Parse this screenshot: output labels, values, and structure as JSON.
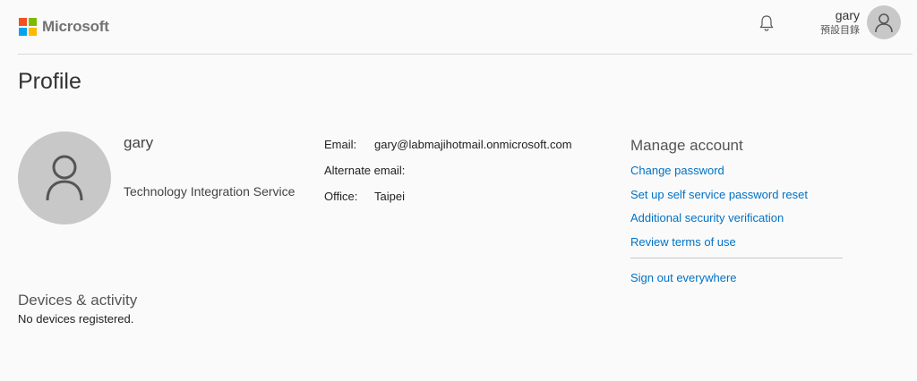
{
  "header": {
    "brand": "Microsoft",
    "user_name": "gary",
    "directory": "預設目錄"
  },
  "profile": {
    "page_title": "Profile",
    "name": "gary",
    "department": "Technology Integration Service",
    "email_label": "Email:",
    "email_value": "gary@labmajihotmail.onmicrosoft.com",
    "alternate_email_label": "Alternate email:",
    "alternate_email_value": "",
    "office_label": "Office:",
    "office_value": "Taipei"
  },
  "manage_account": {
    "title": "Manage account",
    "links": [
      "Change password",
      "Set up self service password reset",
      "Additional security verification",
      "Review terms of use"
    ],
    "sign_out": "Sign out everywhere"
  },
  "devices": {
    "title": "Devices & activity",
    "status": "No devices registered."
  },
  "colors": {
    "link": "#0072c6",
    "avatar_bg": "#c8c8c8",
    "background": "#fafafa"
  }
}
